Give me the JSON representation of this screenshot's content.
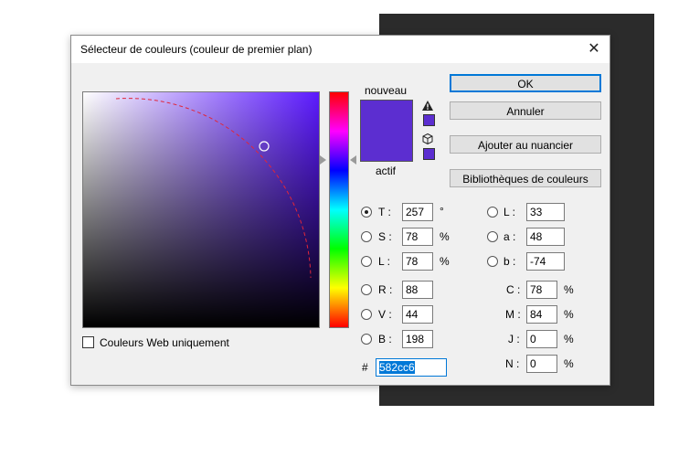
{
  "dialog": {
    "title": "Sélecteur de couleurs (couleur de premier plan)",
    "close_glyph": "✕"
  },
  "preview": {
    "new_label": "nouveau",
    "current_label": "actif",
    "new_color": "#5c2ed0",
    "current_color": "#5c2ed0"
  },
  "icons": {
    "gamut_warning": "warning-icon",
    "web_safe": "cube-icon"
  },
  "buttons": {
    "ok": "OK",
    "cancel": "Annuler",
    "add_swatch": "Ajouter au nuancier",
    "libraries": "Bibliothèques de couleurs"
  },
  "hsb": [
    {
      "label": "T :",
      "value": "257",
      "unit": "°",
      "selected": true
    },
    {
      "label": "S :",
      "value": "78",
      "unit": "%",
      "selected": false
    },
    {
      "label": "L :",
      "value": "78",
      "unit": "%",
      "selected": false
    }
  ],
  "rgb": [
    {
      "label": "R :",
      "value": "88"
    },
    {
      "label": "V :",
      "value": "44"
    },
    {
      "label": "B :",
      "value": "198"
    }
  ],
  "lab": [
    {
      "label": "L :",
      "value": "33"
    },
    {
      "label": "a :",
      "value": "48"
    },
    {
      "label": "b :",
      "value": "-74"
    }
  ],
  "cmyk": [
    {
      "label": "C :",
      "value": "78",
      "unit": "%"
    },
    {
      "label": "M :",
      "value": "84",
      "unit": "%"
    },
    {
      "label": "J :",
      "value": "0",
      "unit": "%"
    },
    {
      "label": "N :",
      "value": "0",
      "unit": "%"
    }
  ],
  "hex": {
    "label": "#",
    "value": "582cc6"
  },
  "web_only": {
    "label": "Couleurs Web uniquement",
    "checked": false
  }
}
